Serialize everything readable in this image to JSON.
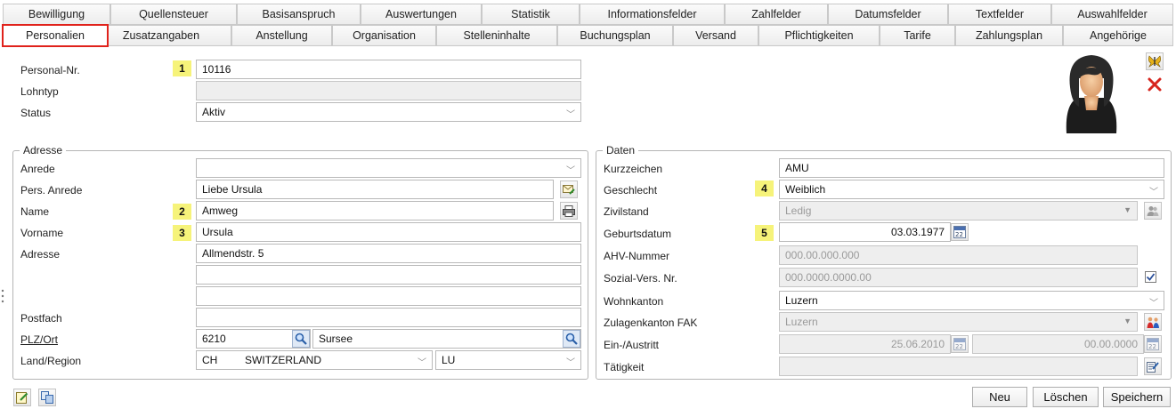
{
  "tabs_row1": [
    "Bewilligung",
    "Quellensteuer",
    "Basisanspruch",
    "Auswertungen",
    "Statistik",
    "Informationsfelder",
    "Zahlfelder",
    "Datumsfelder",
    "Textfelder",
    "Auswahlfelder"
  ],
  "tabs_row2": [
    "Personalien",
    "Zusatzangaben",
    "Anstellung",
    "Organisation",
    "Stelleninhalte",
    "Buchungsplan",
    "Versand",
    "Pflichtigkeiten",
    "Tarife",
    "Zahlungsplan",
    "Angehörige"
  ],
  "active_tab": "Personalien",
  "top": {
    "personal_nr_label": "Personal-Nr.",
    "personal_nr_value": "10116",
    "badge1": "1",
    "lohntyp_label": "Lohntyp",
    "lohntyp_value": "",
    "status_label": "Status",
    "status_value": "Aktiv"
  },
  "adresse": {
    "legend": "Adresse",
    "anrede_label": "Anrede",
    "anrede_value": "",
    "pers_anrede_label": "Pers. Anrede",
    "pers_anrede_value": "Liebe Ursula",
    "name_label": "Name",
    "name_value": "Amweg",
    "badge2": "2",
    "vorname_label": "Vorname",
    "vorname_value": "Ursula",
    "badge3": "3",
    "adresse_label": "Adresse",
    "adresse1": "Allmendstr. 5",
    "adresse2": "",
    "adresse3": "",
    "postfach_label": "Postfach",
    "postfach_value": "",
    "plzort_label": "PLZ/Ort",
    "plz_value": "6210",
    "ort_value": "Sursee",
    "land_label": "Land/Region",
    "land_code": "CH",
    "land_name": "SWITZERLAND",
    "region_value": "LU"
  },
  "daten": {
    "legend": "Daten",
    "kurzzeichen_label": "Kurzzeichen",
    "kurzzeichen_value": "AMU",
    "geschlecht_label": "Geschlecht",
    "geschlecht_value": "Weiblich",
    "badge4": "4",
    "zivilstand_label": "Zivilstand",
    "zivilstand_value": "Ledig",
    "geburtsdatum_label": "Geburtsdatum",
    "geburtsdatum_value": "03.03.1977",
    "badge5": "5",
    "ahv_label": "AHV-Nummer",
    "ahv_value": "000.00.000.000",
    "sozial_label": "Sozial-Vers. Nr.",
    "sozial_value": "000.0000.0000.00",
    "sozial_checked": true,
    "wohnkanton_label": "Wohnkanton",
    "wohnkanton_value": "Luzern",
    "zulagenkanton_label": "Zulagenkanton FAK",
    "zulagenkanton_value": "Luzern",
    "einaus_label": "Ein-/Austritt",
    "eintritt_value": "25.06.2010",
    "austritt_value": "00.00.0000",
    "taetigkeit_label": "Tätigkeit",
    "taetigkeit_value": ""
  },
  "calendar_glyph": "22",
  "buttons": {
    "neu": "Neu",
    "loeschen": "Löschen",
    "speichern": "Speichern"
  },
  "colors": {
    "active_tab_border": "#e0221b",
    "badge": "#f6f37a",
    "disabled": "#eeeeee"
  }
}
